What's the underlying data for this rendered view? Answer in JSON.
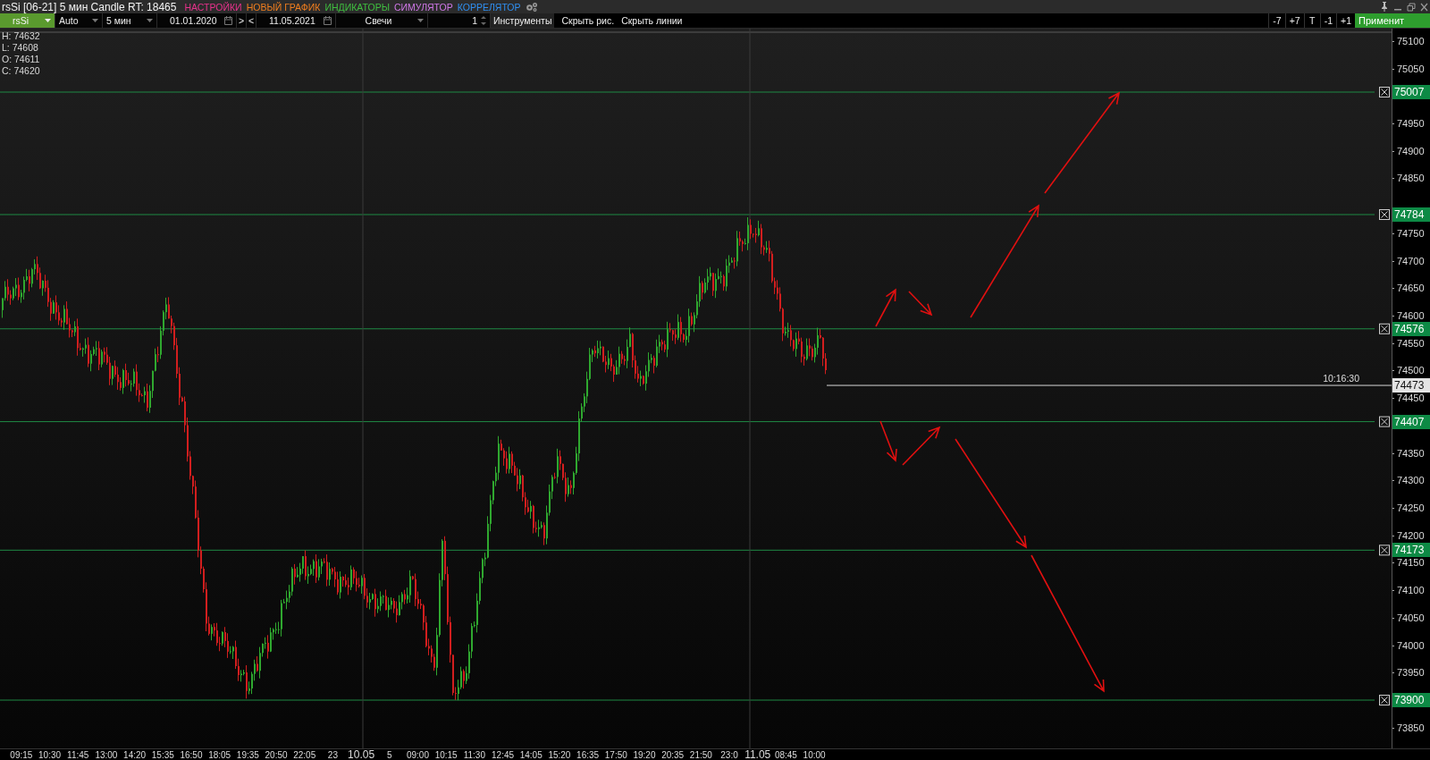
{
  "window": {
    "title": "rsSi [06-21] 5 мин Candle RT: 18465"
  },
  "menu": [
    {
      "label": "НАСТРОЙКИ",
      "color": "#e8328c"
    },
    {
      "label": "НОВЫЙ ГРАФИК",
      "color": "#f07e1e"
    },
    {
      "label": "ИНДИКАТОРЫ",
      "color": "#3fbf3f"
    },
    {
      "label": "СИМУЛЯТОР",
      "color": "#d078e8"
    },
    {
      "label": "КОРРЕЛЯТОР",
      "color": "#2f8ff0"
    }
  ],
  "toolbar": {
    "symbol": "rsSi",
    "scale": "Auto",
    "timeframe": "5 мин",
    "date_from": "01.01.2020",
    "nav_forward": ">",
    "nav_back": "<",
    "date_to": "11.05.2021",
    "chart_type": "Свечи",
    "count": "1",
    "buttons": [
      "Инструменты",
      "Скрыть рис.",
      "Скрыть линии"
    ],
    "shift_buttons": [
      "-7",
      "+7",
      "T",
      "-1",
      "+1"
    ],
    "apply": "Применит"
  },
  "ohlc": [
    "H: 74632",
    "L: 74608",
    "O: 74611",
    "C: 74620"
  ],
  "chart": {
    "price_axis": [
      "75100",
      "75050",
      "74950",
      "74900",
      "74850",
      "74750",
      "74700",
      "74650",
      "74600",
      "74550",
      "74500",
      "74450",
      "74350",
      "74300",
      "74250",
      "74200",
      "74150",
      "74100",
      "74050",
      "74000",
      "73950",
      "73850"
    ],
    "levels": [
      {
        "price": "75007"
      },
      {
        "price": "74784"
      },
      {
        "price": "74576"
      },
      {
        "price": "74407"
      },
      {
        "price": "74173"
      },
      {
        "price": "73900"
      }
    ],
    "current": {
      "price": "74473",
      "time": "10:16:30"
    },
    "time_axis": [
      {
        "label": "09:15",
        "kind": "time"
      },
      {
        "label": "10:30",
        "kind": "time"
      },
      {
        "label": "11:45",
        "kind": "time"
      },
      {
        "label": "13:00",
        "kind": "time"
      },
      {
        "label": "14:20",
        "kind": "time"
      },
      {
        "label": "15:35",
        "kind": "time"
      },
      {
        "label": "16:50",
        "kind": "time"
      },
      {
        "label": "18:05",
        "kind": "time"
      },
      {
        "label": "19:35",
        "kind": "time"
      },
      {
        "label": "20:50",
        "kind": "time"
      },
      {
        "label": "22:05",
        "kind": "time"
      },
      {
        "label": "23",
        "kind": "time"
      },
      {
        "label": "10.05",
        "kind": "date"
      },
      {
        "label": "5",
        "kind": "time"
      },
      {
        "label": "09:00",
        "kind": "time"
      },
      {
        "label": "10:15",
        "kind": "time"
      },
      {
        "label": "11:30",
        "kind": "time"
      },
      {
        "label": "12:45",
        "kind": "time"
      },
      {
        "label": "14:05",
        "kind": "time"
      },
      {
        "label": "15:20",
        "kind": "time"
      },
      {
        "label": "16:35",
        "kind": "time"
      },
      {
        "label": "17:50",
        "kind": "time"
      },
      {
        "label": "19:20",
        "kind": "time"
      },
      {
        "label": "20:35",
        "kind": "time"
      },
      {
        "label": "21:50",
        "kind": "time"
      },
      {
        "label": "23:0",
        "kind": "time"
      },
      {
        "label": "11.05",
        "kind": "date"
      },
      {
        "label": "08:45",
        "kind": "time"
      },
      {
        "label": "10:00",
        "kind": "time"
      }
    ]
  }
}
